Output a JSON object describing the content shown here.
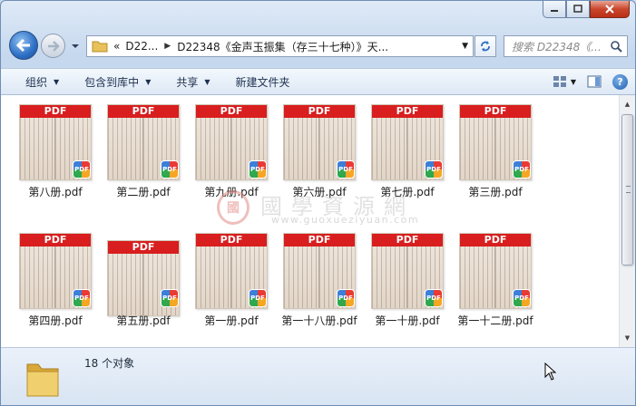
{
  "window": {
    "caption_buttons": [
      "minimize",
      "maximize",
      "close"
    ]
  },
  "nav": {
    "address_crumbs": [
      "«",
      "D22...",
      "D22348《金声玉振集（存三十七种）》天..."
    ],
    "search_placeholder": "搜索 D22348《..."
  },
  "toolbar": {
    "items": [
      "组织",
      "包含到库中",
      "共享",
      "新建文件夹"
    ]
  },
  "files": [
    {
      "name": "第八册.pdf",
      "band": "PDF",
      "badge": "PDF"
    },
    {
      "name": "第二册.pdf",
      "band": "PDF",
      "badge": "PDF"
    },
    {
      "name": "第九册.pdf",
      "band": "PDF",
      "badge": "PDF"
    },
    {
      "name": "第六册.pdf",
      "band": "PDF",
      "badge": "PDF"
    },
    {
      "name": "第七册.pdf",
      "band": "PDF",
      "badge": "PDF"
    },
    {
      "name": "第三册.pdf",
      "band": "PDF",
      "badge": "PDF"
    },
    {
      "name": "第四册.pdf",
      "band": "PDF",
      "badge": "PDF"
    },
    {
      "name": "第五册.pdf",
      "band": "PDF",
      "badge": "PDF"
    },
    {
      "name": "第一册.pdf",
      "band": "PDF",
      "badge": "PDF"
    },
    {
      "name": "第一十八册.pdf",
      "band": "PDF",
      "badge": "PDF"
    },
    {
      "name": "第一十册.pdf",
      "band": "PDF",
      "badge": "PDF"
    },
    {
      "name": "第一十二册.pdf",
      "band": "PDF",
      "badge": "PDF"
    }
  ],
  "watermark": {
    "seal": "國",
    "title": "國學資源網",
    "url": "www.guoxueziyuan.com"
  },
  "status": {
    "count": "18 个对象"
  },
  "colors": {
    "pdf_band": "#d81e1e",
    "window_frame": "#c6d8ee",
    "close_button": "#c9462c"
  }
}
